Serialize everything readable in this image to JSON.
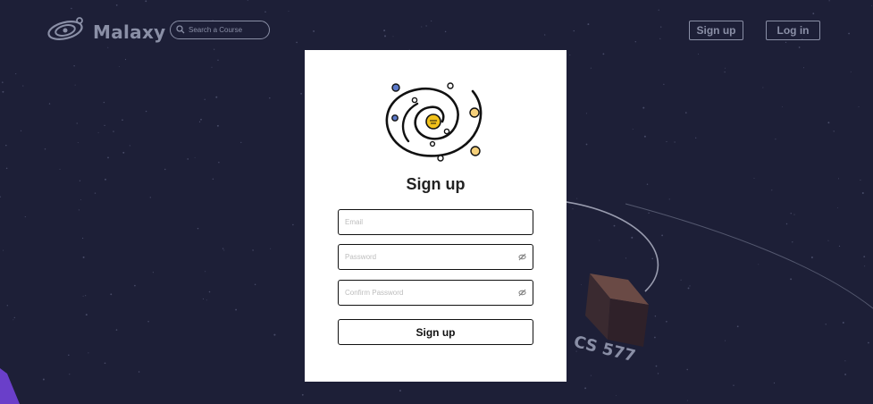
{
  "header": {
    "brand": "Malaxy",
    "search_placeholder": "Search a Course",
    "signup_label": "Sign up",
    "login_label": "Log in"
  },
  "card": {
    "title": "Sign up",
    "email_placeholder": "Email",
    "password_placeholder": "Password",
    "confirm_placeholder": "Confirm Password",
    "submit_label": "Sign up"
  },
  "scene": {
    "planet_label": "CS 577"
  },
  "colors": {
    "background": "#1d1f37",
    "muted": "#8a8fa6",
    "card": "#ffffff",
    "accent_yellow": "#f2c21b",
    "accent_purple": "#6a3fc9"
  }
}
